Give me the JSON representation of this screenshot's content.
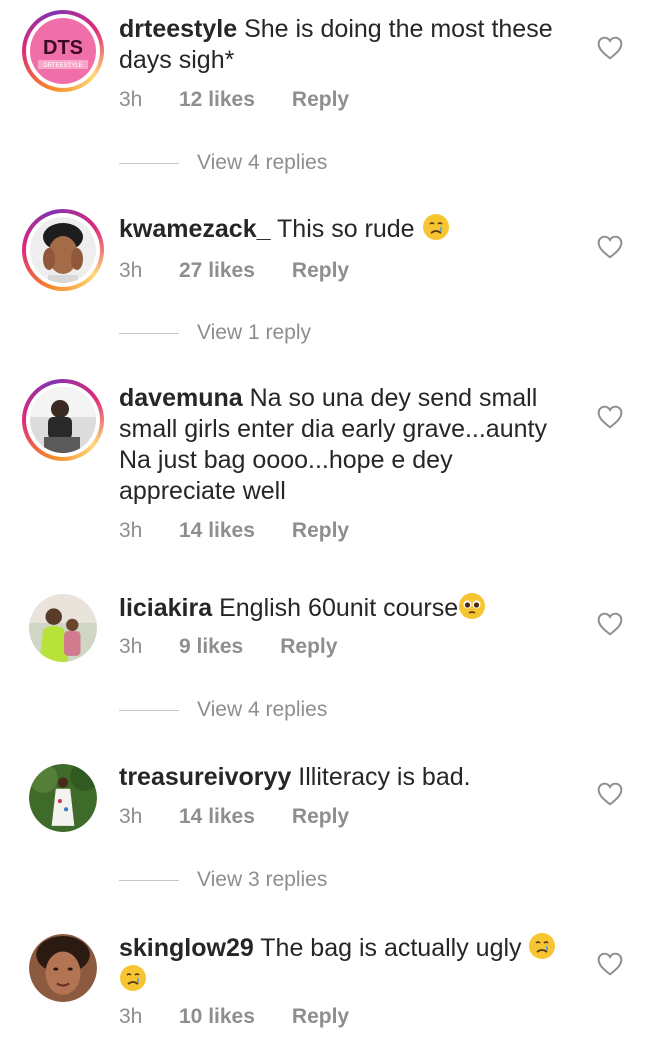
{
  "comments": [
    {
      "username": "drteestyle",
      "text": "She is doing the most these days sigh*",
      "time": "3h",
      "likes": "12 likes",
      "reply": "Reply",
      "view_replies": "View 4 replies",
      "avatar_text": "DTS",
      "avatar_subtext": "DRTEESTYLE"
    },
    {
      "username": "kwamezack_",
      "text": "This so rude",
      "time": "3h",
      "likes": "27 likes",
      "reply": "Reply",
      "view_replies": "View 1 reply"
    },
    {
      "username": "davemuna",
      "text": "Na so una dey send small small girls enter dia early grave...aunty Na just bag oooo...hope e dey appreciate well",
      "time": "3h",
      "likes": "14 likes",
      "reply": "Reply"
    },
    {
      "username": "liciakira",
      "text": "English 60unit course",
      "time": "3h",
      "likes": "9 likes",
      "reply": "Reply",
      "view_replies": "View 4 replies"
    },
    {
      "username": "treasureivoryy",
      "text": "Illiteracy is bad.",
      "time": "3h",
      "likes": "14 likes",
      "reply": "Reply",
      "view_replies": "View 3 replies"
    },
    {
      "username": "skinglow29",
      "text": "The bag is actually ugly",
      "time": "3h",
      "likes": "10 likes",
      "reply": "Reply"
    }
  ],
  "icons": {
    "like": "heart-outline-icon",
    "crying_emoji": "crying-face-emoji",
    "pleading_emoji": "pleading-face-emoji"
  },
  "colors": {
    "text": "#262626",
    "meta": "#8e8e8e",
    "story_ring_start": "#f58529",
    "story_ring_end": "#dd2a7b"
  }
}
